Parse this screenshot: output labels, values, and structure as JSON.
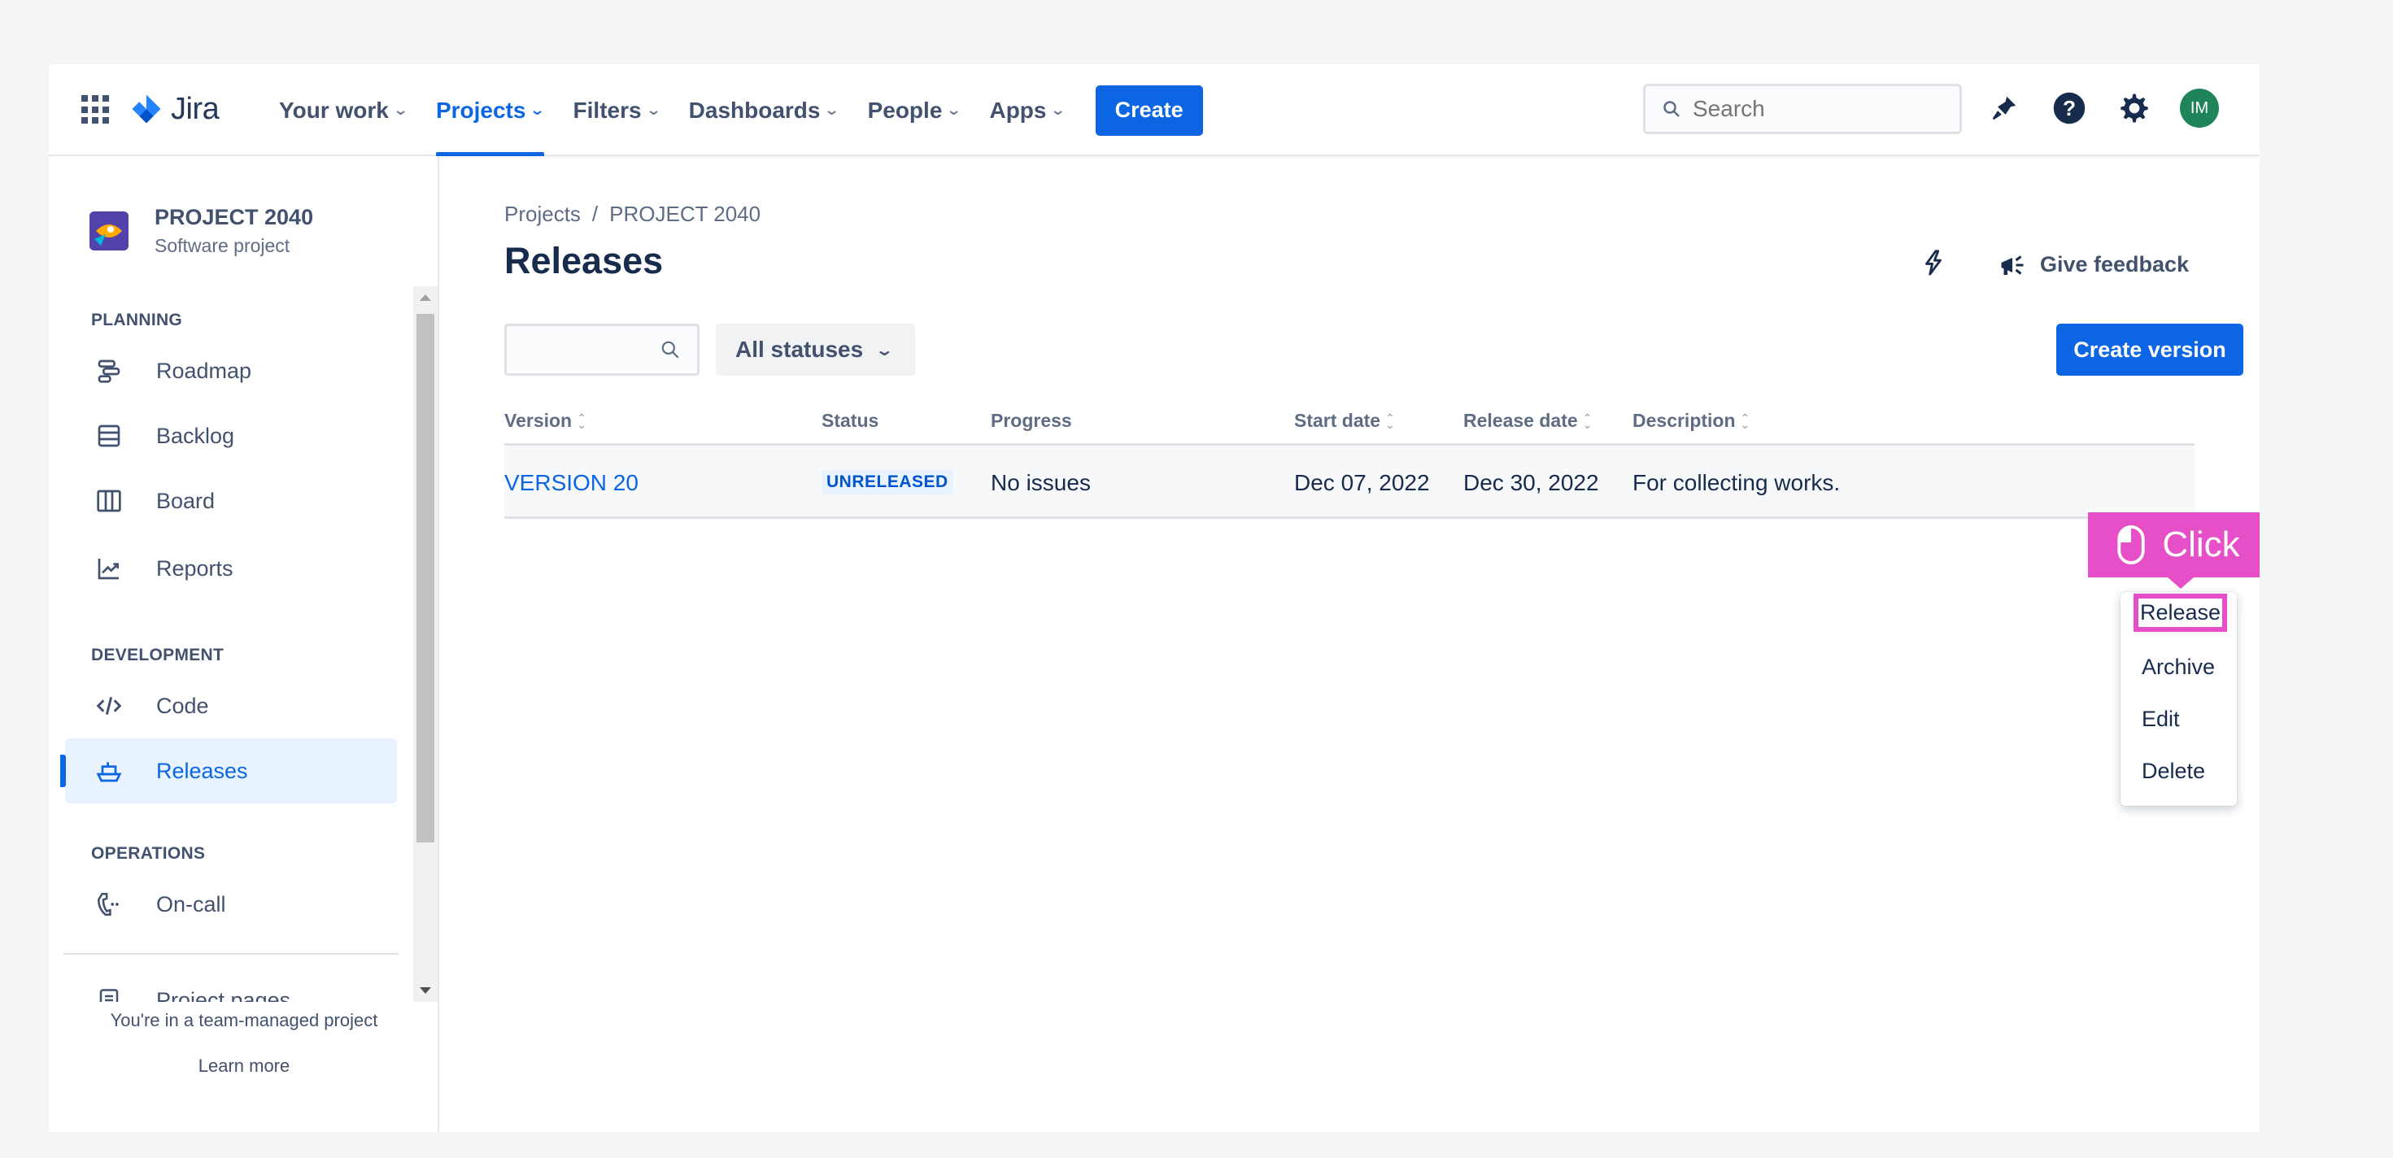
{
  "nav": {
    "product": "Jira",
    "items": [
      {
        "label": "Your work",
        "active": false
      },
      {
        "label": "Projects",
        "active": true
      },
      {
        "label": "Filters",
        "active": false
      },
      {
        "label": "Dashboards",
        "active": false
      },
      {
        "label": "People",
        "active": false
      },
      {
        "label": "Apps",
        "active": false
      }
    ],
    "create_label": "Create",
    "search_placeholder": "Search",
    "avatar_initials": "IM",
    "accent": "#0c66e4"
  },
  "sidebar": {
    "project_name": "PROJECT 2040",
    "project_type": "Software project",
    "sections": {
      "planning": "PLANNING",
      "development": "DEVELOPMENT",
      "operations": "OPERATIONS"
    },
    "items": {
      "roadmap": "Roadmap",
      "backlog": "Backlog",
      "board": "Board",
      "reports": "Reports",
      "code": "Code",
      "releases": "Releases",
      "oncall": "On-call",
      "project_pages": "Project pages"
    },
    "footer_note": "You're in a team-managed project",
    "footer_link": "Learn more"
  },
  "main": {
    "breadcrumb_projects": "Projects",
    "breadcrumb_sep": "/",
    "breadcrumb_project": "PROJECT 2040",
    "title": "Releases",
    "feedback_label": "Give feedback",
    "status_filter": "All statuses",
    "create_version_label": "Create version",
    "columns": {
      "version": "Version",
      "status": "Status",
      "progress": "Progress",
      "start_date": "Start date",
      "release_date": "Release date",
      "description": "Description"
    },
    "rows": [
      {
        "version": "VERSION 20",
        "status": "UNRELEASED",
        "progress": "No issues",
        "start_date": "Dec 07, 2022",
        "release_date": "Dec 30, 2022",
        "description": "For collecting works."
      }
    ]
  },
  "callout": {
    "label": "Click",
    "color": "#e64fc7"
  },
  "menu": {
    "release": "Release",
    "archive": "Archive",
    "edit": "Edit",
    "delete": "Delete"
  }
}
